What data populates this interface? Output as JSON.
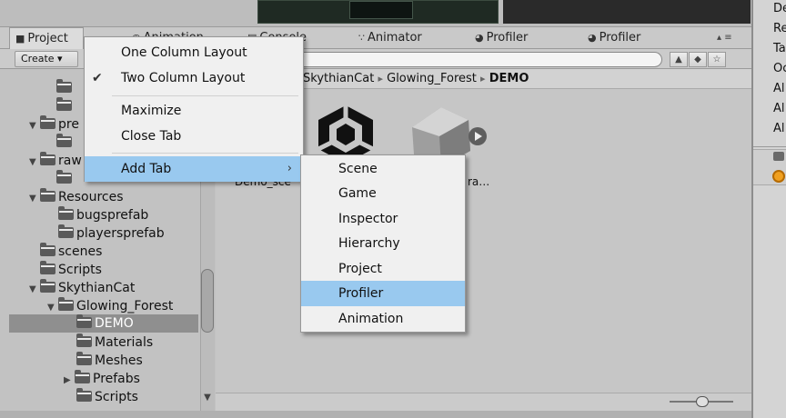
{
  "tabs": [
    {
      "label": "Project",
      "icon": "folder-icon"
    },
    {
      "label": "Animation",
      "icon": "animation-icon"
    },
    {
      "label": "Console",
      "icon": "console-icon"
    },
    {
      "label": "Animator",
      "icon": "animator-icon"
    },
    {
      "label": "Profiler",
      "icon": "profiler-icon"
    },
    {
      "label": "Profiler",
      "icon": "profiler-icon"
    }
  ],
  "toolbar": {
    "create_label": "Create ▾",
    "search_placeholder": ""
  },
  "tree": {
    "items": [
      {
        "label": "",
        "depth": 3
      },
      {
        "label": "",
        "depth": 3
      },
      {
        "label": "pre",
        "depth": 1
      },
      {
        "label": "",
        "depth": 3
      },
      {
        "label": "raw",
        "depth": 1
      },
      {
        "label": "",
        "depth": 3
      },
      {
        "label": "Resources",
        "depth": 1
      },
      {
        "label": "bugsprefab",
        "depth": 2
      },
      {
        "label": "playersprefab",
        "depth": 2
      },
      {
        "label": "scenes",
        "depth": 1
      },
      {
        "label": "Scripts",
        "depth": 1
      },
      {
        "label": "SkythianCat",
        "depth": 1
      },
      {
        "label": "Glowing_Forest",
        "depth": 2
      },
      {
        "label": "DEMO",
        "depth": 3
      },
      {
        "label": "Materials",
        "depth": 3
      },
      {
        "label": "Meshes",
        "depth": 3
      },
      {
        "label": "Prefabs",
        "depth": 3
      },
      {
        "label": "Scripts",
        "depth": 3
      }
    ]
  },
  "breadcrumb": {
    "part1": "SkythianCat",
    "sep": "▸",
    "part2": "Glowing_Forest",
    "current": "DEMO"
  },
  "assets": [
    {
      "label": "Demo_sce",
      "type": "unity-scene"
    },
    {
      "label": "ra…",
      "type": "prefab"
    }
  ],
  "context_menu": {
    "items": [
      {
        "label": "One Column Layout",
        "checked": false
      },
      {
        "label": "Two Column Layout",
        "checked": true
      },
      {
        "label": "Maximize",
        "checked": false
      },
      {
        "label": "Close Tab",
        "checked": false
      },
      {
        "label": "Add Tab",
        "checked": false,
        "submenu": true
      }
    ]
  },
  "submenu": {
    "items": [
      "Scene",
      "Game",
      "Inspector",
      "Hierarchy",
      "Project",
      "Profiler",
      "Animation"
    ],
    "highlighted": "Profiler"
  },
  "right_panel": {
    "items": [
      "De",
      "Re",
      "Ta",
      "Oc",
      "Al",
      "Al",
      "Al"
    ]
  },
  "colors": {
    "menu_highlight": "#99c9ef",
    "selected_row": "#8f8f8f"
  }
}
